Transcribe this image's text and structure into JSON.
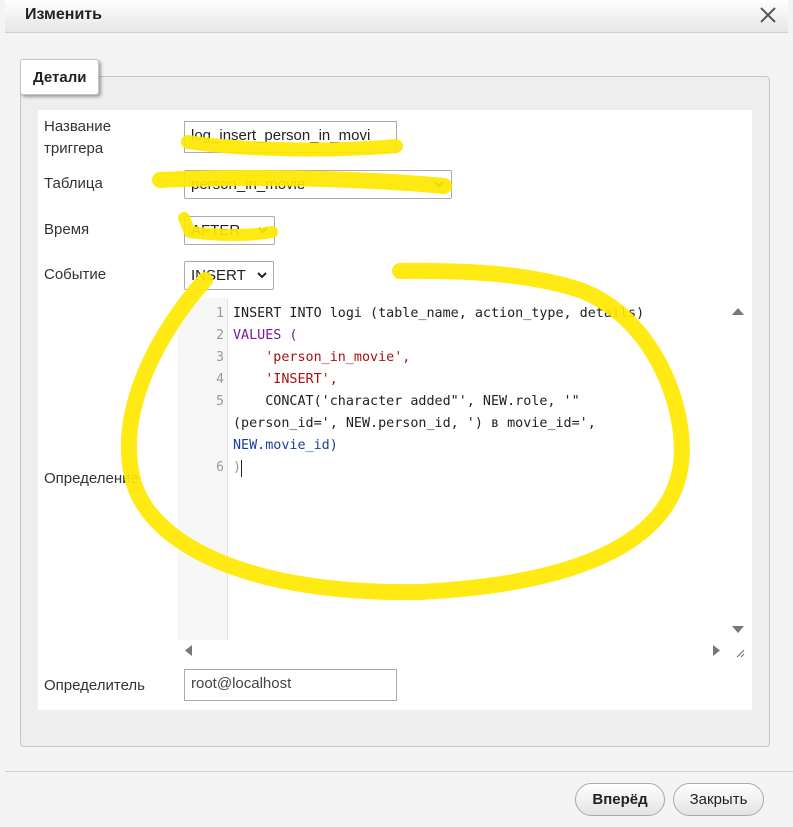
{
  "dialog": {
    "title": "Изменить",
    "legend": "Детали",
    "fields": {
      "name_label": "Название триггера",
      "name_value": "log_insert_person_in_movi",
      "table_label": "Таблица",
      "table_value": "person_in_movie",
      "time_label": "Время",
      "time_value": "AFTER",
      "event_label": "Событие",
      "event_value": "INSERT",
      "definition_label": "Определение",
      "definer_label": "Определитель",
      "definer_value": "root@localhost"
    },
    "editor": {
      "line_numbers": [
        "1",
        "2",
        "3",
        "4",
        "5",
        "6"
      ],
      "code_lines": [
        "INSERT INTO logi (table_name, action_type, details)",
        "VALUES (",
        "    'person_in_movie',",
        "    'INSERT',",
        "    CONCAT('character added\"', NEW.role, '\"",
        "(person_id=', NEW.person_id, ') в movie_id=',",
        "NEW.movie_id)",
        ")"
      ]
    },
    "buttons": {
      "forward": "Вперёд",
      "close": "Закрыть"
    }
  },
  "colors": {
    "highlight": "#ffe800",
    "keyword": "#7a1a9a",
    "string": "#a11111",
    "property": "#1a3f9e"
  },
  "icons": [
    "close-icon",
    "chevron-down-icon",
    "scroll-up-icon",
    "scroll-down-icon",
    "scroll-left-icon",
    "scroll-right-icon",
    "resize-grip-icon"
  ]
}
